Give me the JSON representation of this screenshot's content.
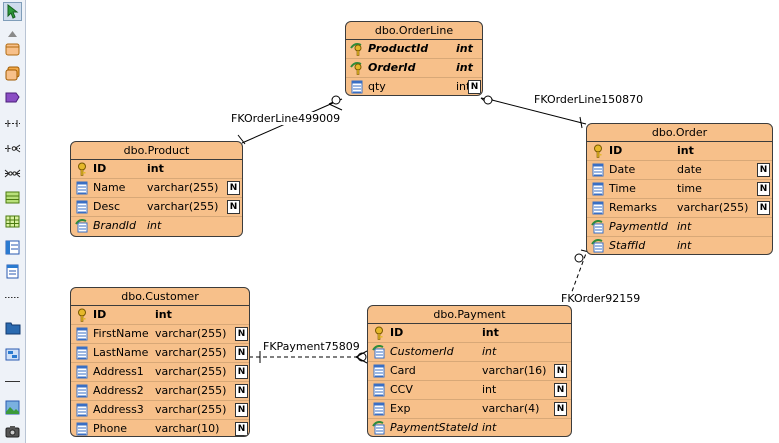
{
  "toolbar": {
    "tools": [
      "select-icon",
      "scroll-up-icon",
      "entity-icon",
      "view-icon",
      "stored-procedure-icon",
      "one-to-one-relationship-icon",
      "one-to-many-relationship-icon",
      "many-to-many-relationship-icon",
      "table-record-icon",
      "table-grid-icon",
      "column-list-icon",
      "note-icon",
      "dashed-line-icon",
      "package-icon",
      "database-icon",
      "line-icon",
      "image-icon",
      "camera-icon"
    ]
  },
  "entities": {
    "orderline": {
      "title": "dbo.OrderLine",
      "columns": [
        {
          "name": "ProductId",
          "type": "int",
          "key": "pkfk",
          "nullable": false
        },
        {
          "name": "OrderId",
          "type": "int",
          "key": "pkfk",
          "nullable": false
        },
        {
          "name": "qty",
          "type": "int",
          "key": "none",
          "nullable": true
        }
      ]
    },
    "product": {
      "title": "dbo.Product",
      "columns": [
        {
          "name": "ID",
          "type": "int",
          "key": "pk",
          "nullable": false
        },
        {
          "name": "Name",
          "type": "varchar(255)",
          "key": "none",
          "nullable": true
        },
        {
          "name": "Desc",
          "type": "varchar(255)",
          "key": "none",
          "nullable": true
        },
        {
          "name": "BrandId",
          "type": "int",
          "key": "fk",
          "nullable": false
        }
      ]
    },
    "order": {
      "title": "dbo.Order",
      "columns": [
        {
          "name": "ID",
          "type": "int",
          "key": "pk",
          "nullable": false
        },
        {
          "name": "Date",
          "type": "date",
          "key": "none",
          "nullable": true
        },
        {
          "name": "Time",
          "type": "time",
          "key": "none",
          "nullable": true
        },
        {
          "name": "Remarks",
          "type": "varchar(255)",
          "key": "none",
          "nullable": true
        },
        {
          "name": "PaymentId",
          "type": "int",
          "key": "fk",
          "nullable": false
        },
        {
          "name": "StaffId",
          "type": "int",
          "key": "fk",
          "nullable": false
        }
      ]
    },
    "customer": {
      "title": "dbo.Customer",
      "columns": [
        {
          "name": "ID",
          "type": "int",
          "key": "pk",
          "nullable": false
        },
        {
          "name": "FirstName",
          "type": "varchar(255)",
          "key": "none",
          "nullable": true
        },
        {
          "name": "LastName",
          "type": "varchar(255)",
          "key": "none",
          "nullable": true
        },
        {
          "name": "Address1",
          "type": "varchar(255)",
          "key": "none",
          "nullable": true
        },
        {
          "name": "Address2",
          "type": "varchar(255)",
          "key": "none",
          "nullable": true
        },
        {
          "name": "Address3",
          "type": "varchar(255)",
          "key": "none",
          "nullable": true
        },
        {
          "name": "Phone",
          "type": "varchar(10)",
          "key": "none",
          "nullable": true
        }
      ]
    },
    "payment": {
      "title": "dbo.Payment",
      "columns": [
        {
          "name": "ID",
          "type": "int",
          "key": "pk",
          "nullable": false
        },
        {
          "name": "CustomerId",
          "type": "int",
          "key": "fk",
          "nullable": false
        },
        {
          "name": "Card",
          "type": "varchar(16)",
          "key": "none",
          "nullable": true
        },
        {
          "name": "CCV",
          "type": "int",
          "key": "none",
          "nullable": true
        },
        {
          "name": "Exp",
          "type": "varchar(4)",
          "key": "none",
          "nullable": true
        },
        {
          "name": "PaymentStateId",
          "type": "int",
          "key": "fk",
          "nullable": false
        }
      ]
    }
  },
  "relationships": {
    "fk_orderline_product": "FKOrderLine499009",
    "fk_orderline_order": "FKOrderLine150870",
    "fk_order_payment": "FKOrder92159",
    "fk_payment_customer": "FKPayment75809"
  },
  "null_marker": "N",
  "colors": {
    "entity_fill": "#f7c08a",
    "entity_border": "#3c3c3c",
    "key_gold": "#e5b82a",
    "fk_green": "#2e8b3a",
    "column_blue": "#3a6fc4"
  }
}
